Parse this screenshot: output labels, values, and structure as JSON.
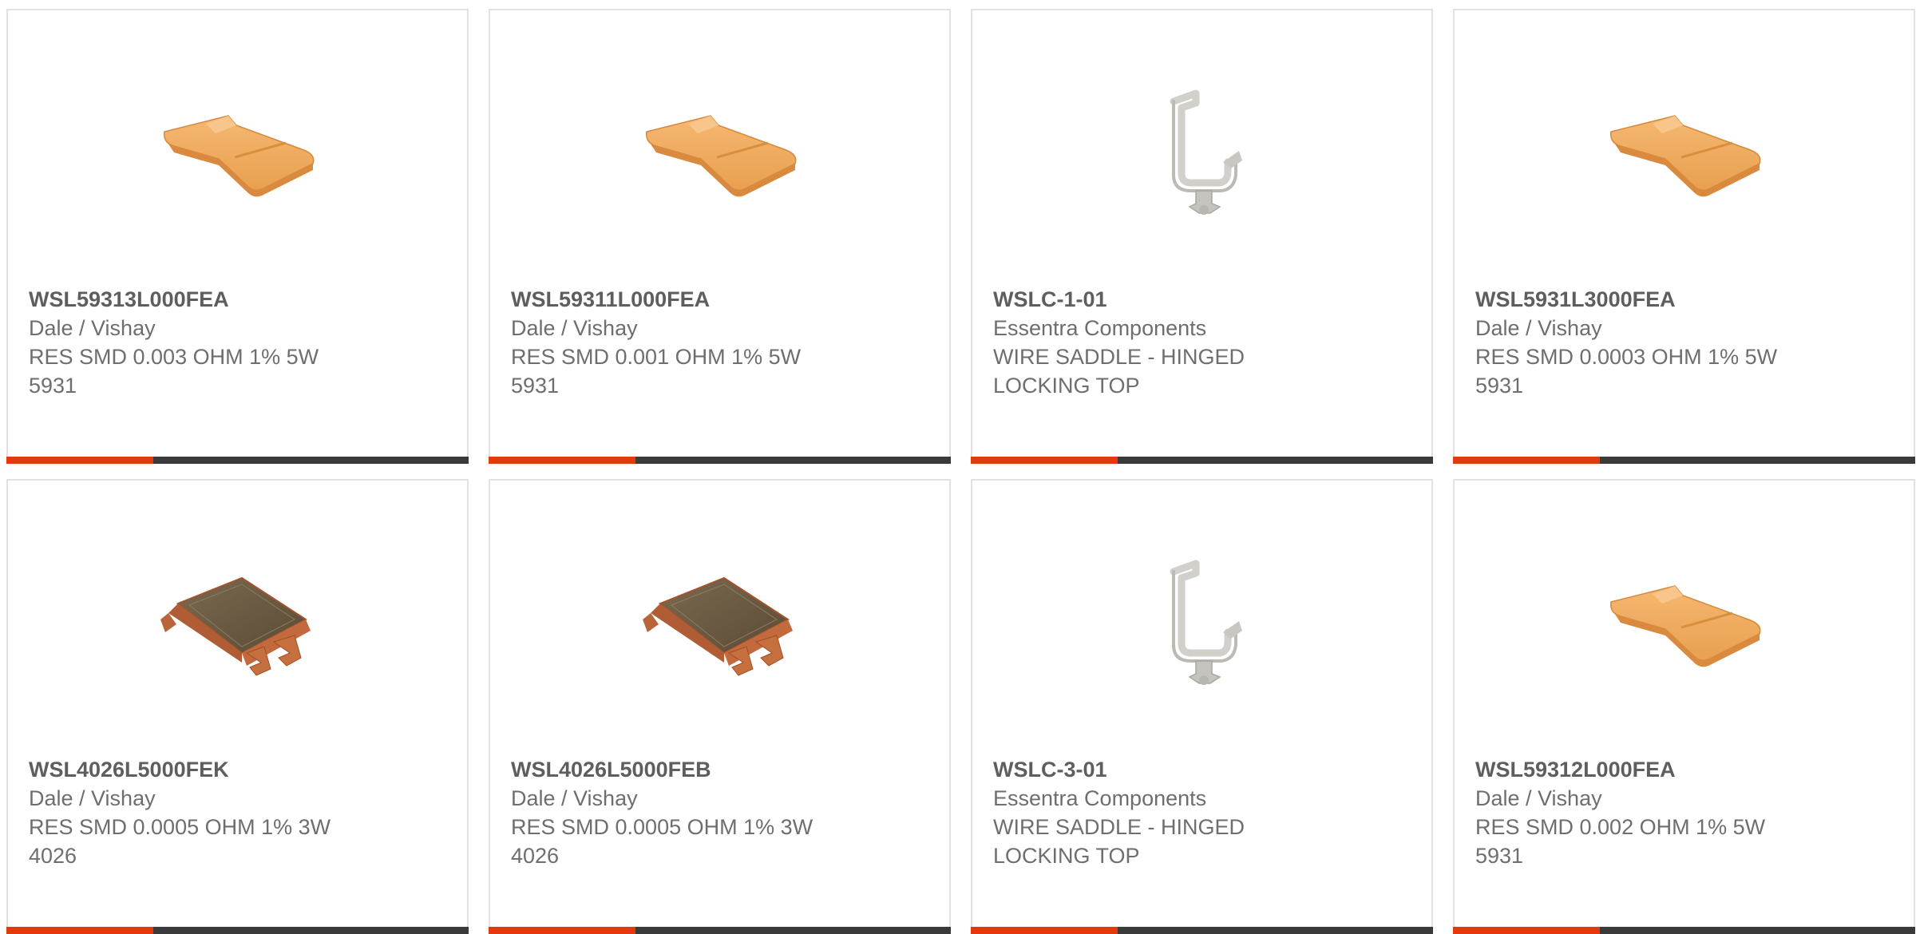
{
  "products": [
    {
      "part_number": "WSL59313L000FEA",
      "manufacturer": "Dale / Vishay",
      "description": "RES SMD 0.003 OHM 1% 5W 5931",
      "icon": "orange-strip-resistor-icon"
    },
    {
      "part_number": "WSL59311L000FEA",
      "manufacturer": "Dale / Vishay",
      "description": "RES SMD 0.001 OHM 1% 5W 5931",
      "icon": "orange-strip-resistor-icon"
    },
    {
      "part_number": "WSLC-1-01",
      "manufacturer": "Essentra Components",
      "description": "WIRE SADDLE - HINGED LOCKING TOP",
      "icon": "wire-saddle-icon"
    },
    {
      "part_number": "WSL5931L3000FEA",
      "manufacturer": "Dale / Vishay",
      "description": "RES SMD 0.0003 OHM 1% 5W 5931",
      "icon": "orange-strip-resistor-icon"
    },
    {
      "part_number": "WSL4026L5000FEK",
      "manufacturer": "Dale / Vishay",
      "description": "RES SMD 0.0005 OHM 1% 3W 4026",
      "icon": "copper-shunt-resistor-icon"
    },
    {
      "part_number": "WSL4026L5000FEB",
      "manufacturer": "Dale / Vishay",
      "description": "RES SMD 0.0005 OHM 1% 3W 4026",
      "icon": "copper-shunt-resistor-icon"
    },
    {
      "part_number": "WSLC-3-01",
      "manufacturer": "Essentra Components",
      "description": "WIRE SADDLE - HINGED LOCKING TOP",
      "icon": "wire-saddle-icon"
    },
    {
      "part_number": "WSL59312L000FEA",
      "manufacturer": "Dale / Vishay",
      "description": "RES SMD 0.002 OHM 1% 5W 5931",
      "icon": "orange-strip-resistor-icon"
    }
  ],
  "colors": {
    "accent": "#e13a0e",
    "bar": "#3a3a3a",
    "border": "#e1e1e1",
    "text": "#6e6e6e"
  }
}
